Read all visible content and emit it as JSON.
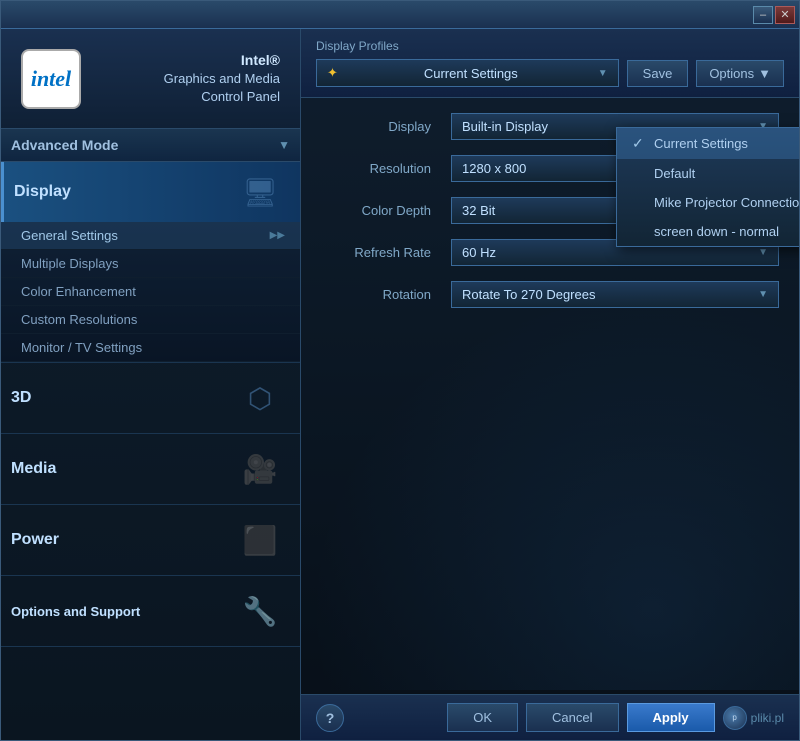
{
  "window": {
    "title": "Intel Graphics and Media Control Panel",
    "min_btn": "–",
    "close_btn": "✕"
  },
  "sidebar": {
    "intel_logo": "intel",
    "brand_line1": "Intel®",
    "brand_line2": "Graphics and Media",
    "brand_line3": "Control Panel",
    "mode_label": "Advanced Mode",
    "nav_items": [
      {
        "id": "display",
        "label": "Display",
        "active": true
      },
      {
        "id": "3d",
        "label": "3D",
        "active": false
      },
      {
        "id": "media",
        "label": "Media",
        "active": false
      },
      {
        "id": "power",
        "label": "Power",
        "active": false
      },
      {
        "id": "options",
        "label": "Options and Support",
        "active": false
      }
    ],
    "submenu_items": [
      {
        "id": "general",
        "label": "General Settings",
        "active": true,
        "has_arrow": true
      },
      {
        "id": "multiple",
        "label": "Multiple Displays",
        "active": false
      },
      {
        "id": "color",
        "label": "Color Enhancement",
        "active": false
      },
      {
        "id": "custom",
        "label": "Custom Resolutions",
        "active": false
      },
      {
        "id": "monitor",
        "label": "Monitor / TV Settings",
        "active": false
      }
    ]
  },
  "right_panel": {
    "profiles": {
      "label": "Display Profiles",
      "current_value": "Current Settings",
      "star": "✦",
      "save_btn": "Save",
      "options_btn": "Options",
      "dropdown_items": [
        {
          "id": "current",
          "label": "Current Settings",
          "selected": true
        },
        {
          "id": "default",
          "label": "Default"
        },
        {
          "id": "mike",
          "label": "Mike Projector Connection"
        },
        {
          "id": "screen_down",
          "label": "screen down - normal"
        }
      ]
    },
    "settings": {
      "display_label": "Display",
      "display_value": "Built-in Display",
      "resolution_label": "Resolution",
      "resolution_value": "1280 x 800",
      "color_depth_label": "Color Depth",
      "color_depth_value": "32 Bit",
      "refresh_rate_label": "Refresh Rate",
      "refresh_rate_value": "60 Hz",
      "rotation_label": "Rotation",
      "rotation_value": "Rotate To 270 Degrees"
    },
    "bottom": {
      "help_label": "?",
      "ok_label": "OK",
      "cancel_label": "Cancel",
      "apply_label": "Apply",
      "branding": "pliki.pl"
    }
  }
}
